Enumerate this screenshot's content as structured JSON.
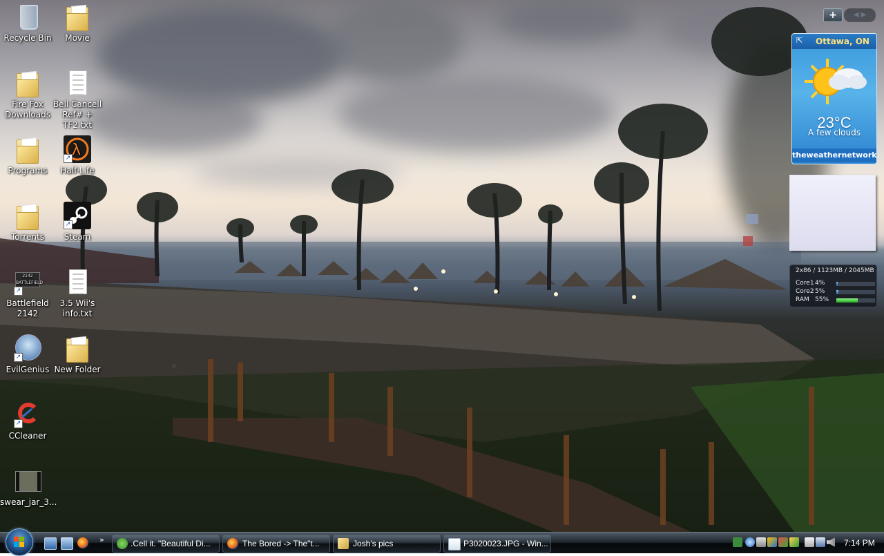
{
  "desktop": {
    "icons": [
      {
        "label": "Recycle Bin"
      },
      {
        "label": "Movie"
      },
      {
        "label": "Fire Fox\nDownloads"
      },
      {
        "label": "Bell Cancell\nRef# + TF2.txt"
      },
      {
        "label": "Programs"
      },
      {
        "label": "Half-Life"
      },
      {
        "label": "Torrents"
      },
      {
        "label": "Steam"
      },
      {
        "label": "Battlefield\n2142"
      },
      {
        "label": "3.5 Wii's\ninfo.txt"
      },
      {
        "label": "EvilGenius"
      },
      {
        "label": "New Folder"
      },
      {
        "label": "CCleaner"
      },
      {
        "label": "swear_jar_3..."
      }
    ]
  },
  "sidebar": {
    "add_label": "+",
    "nav_label": "◀ ▶",
    "weather": {
      "city": "Ottawa, ON",
      "temperature": "23°C",
      "condition": "A few clouds",
      "brand": "theweathernetwork.com"
    },
    "meter": {
      "title": "2x86 / 1123MB / 2045MB",
      "rows": [
        {
          "label": "Core1",
          "percent_text": "4%",
          "percent": 4
        },
        {
          "label": "Core2",
          "percent_text": "5%",
          "percent": 5
        },
        {
          "label": "RAM",
          "percent_text": "55%",
          "percent": 55
        }
      ]
    }
  },
  "taskbar": {
    "more_label": "»",
    "buttons": [
      {
        "label": ".Cell it. \"Beautiful Di...",
        "icon": "messenger-icon"
      },
      {
        "label": "The Bored -> The\"t...",
        "icon": "firefox-icon"
      },
      {
        "label": "Josh's pics",
        "icon": "folder-icon"
      },
      {
        "label": "P3020023.JPG - Win...",
        "icon": "photo-gallery-icon"
      }
    ],
    "clock": "7:14 PM"
  },
  "colors": {
    "weather_city": "#ffe37a",
    "ram_bar": "#1ea81e",
    "core_bar": "#1e5ea8"
  }
}
